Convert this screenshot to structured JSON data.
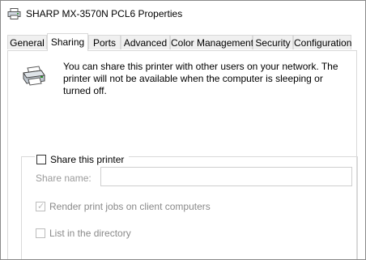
{
  "window": {
    "title": "SHARP MX-3570N PCL6 Properties"
  },
  "tabs": [
    {
      "label": "General",
      "active": false
    },
    {
      "label": "Sharing",
      "active": true
    },
    {
      "label": "Ports",
      "active": false
    },
    {
      "label": "Advanced",
      "active": false
    },
    {
      "label": "Color Management",
      "active": false
    },
    {
      "label": "Security",
      "active": false
    },
    {
      "label": "Configuration",
      "active": false
    }
  ],
  "sharing": {
    "info_text": "You can share this printer with other users on your network. The printer will not be available when the computer is sleeping or turned off.",
    "share_checkbox_label": "Share this printer",
    "share_checked": false,
    "share_name_label": "Share name:",
    "share_name_value": "",
    "render_label": "Render print jobs on client computers",
    "render_checked": true,
    "render_enabled": false,
    "directory_label": "List in the directory",
    "directory_checked": false,
    "directory_enabled": false
  },
  "icons": {
    "title_icon": "printer-icon",
    "panel_icon": "printer-icon"
  }
}
